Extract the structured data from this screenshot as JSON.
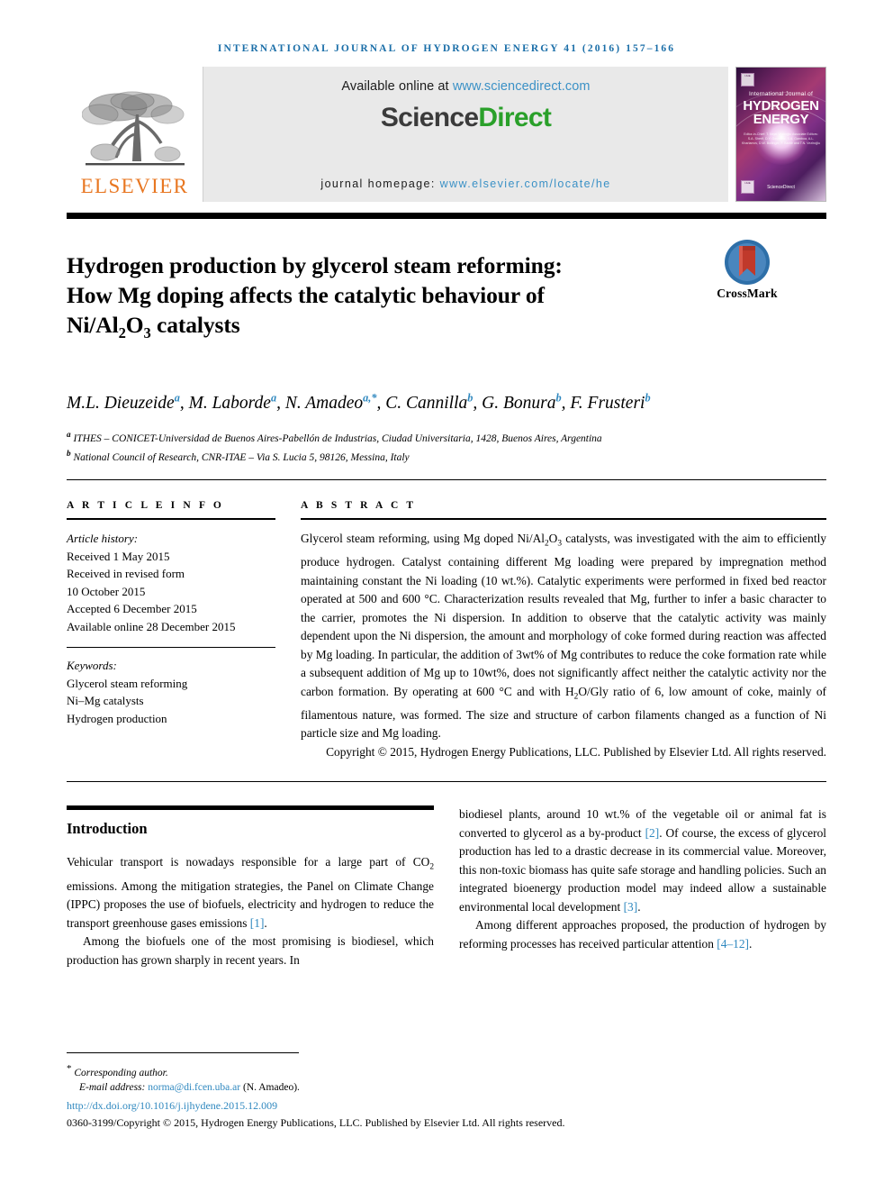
{
  "running_head": "International Journal of Hydrogen Energy 41 (2016) 157–166",
  "masthead": {
    "publisher_name": "ELSEVIER",
    "publisher_logo_name": "elsevier-tree-logo",
    "available_prefix": "Available online at ",
    "available_link": "www.sciencedirect.com",
    "sciencedirect_part1": "Science",
    "sciencedirect_part2": "Direct",
    "homepage_label": "journal homepage: ",
    "homepage_link": "www.elsevier.com/locate/he",
    "cover": {
      "line_small": "International Journal of",
      "line_big_1": "HYDROGEN",
      "line_big_2": "ENERGY",
      "editors": "Editor-in-Chief: T. Nejat Veziroğlu    Associate Editors: S.A. Sherif, D.Y. Goswami, S.A. Gamboa, A.L. Kharlamov, D.W. Bollinger, F. Barbir and T.N. Veziroğlu",
      "sciencedirect_mark": "ScienceDirect"
    }
  },
  "article": {
    "title_line1": "Hydrogen production by glycerol steam reforming:",
    "title_line2": "How Mg doping affects the catalytic behaviour of",
    "title_line3_pre": "Ni/Al",
    "title_sub1": "2",
    "title_line3_mid": "O",
    "title_sub2": "3",
    "title_line3_post": " catalysts",
    "crossmark_label": "CrossMark",
    "authors": [
      {
        "name": "M.L. Dieuzeide",
        "sup": "a",
        "sep": ", "
      },
      {
        "name": "M. Laborde",
        "sup": "a",
        "sep": ", "
      },
      {
        "name": "N. Amadeo",
        "sup": "a,*",
        "sep": ", "
      },
      {
        "name": "C. Cannilla",
        "sup": "b",
        "sep": ", "
      },
      {
        "name": "G. Bonura",
        "sup": "b",
        "sep": ", "
      },
      {
        "name": "F. Frusteri",
        "sup": "b",
        "sep": ""
      }
    ],
    "affiliations": [
      {
        "marker": "a",
        "text": "ITHES – CONICET-Universidad de Buenos Aires-Pabellón de Industrias, Ciudad Universitaria, 1428, Buenos Aires, Argentina"
      },
      {
        "marker": "b",
        "text": "National Council of Research, CNR-ITAE – Via S. Lucia 5, 98126, Messina, Italy"
      }
    ]
  },
  "article_info": {
    "heading": "A R T I C L E   I N F O",
    "history_label": "Article history:",
    "history": [
      "Received 1 May 2015",
      "Received in revised form",
      "10 October 2015",
      "Accepted 6 December 2015",
      "Available online 28 December 2015"
    ],
    "keywords_label": "Keywords:",
    "keywords": [
      "Glycerol steam reforming",
      "Ni–Mg catalysts",
      "Hydrogen production"
    ]
  },
  "abstract": {
    "heading": "A B S T R A C T",
    "part1": "Glycerol steam reforming, using Mg doped Ni/Al",
    "sub1": "2",
    "part2": "O",
    "sub2": "3",
    "part3": " catalysts, was investigated with the aim to efficiently produce hydrogen. Catalyst containing different Mg loading were prepared by impregnation method maintaining constant the Ni loading (10 wt.%). Catalytic experiments were performed in fixed bed reactor operated at 500 and 600 °C. Characterization results revealed that Mg, further to infer a basic character to the carrier, promotes the Ni dispersion. In addition to observe that the catalytic activity was mainly dependent upon the Ni dispersion, the amount and morphology of coke formed during reaction was affected by Mg loading. In particular, the addition of 3wt% of Mg contributes to reduce the coke formation rate while a subsequent addition of Mg up to 10wt%, does not significantly affect neither the catalytic activity nor the carbon formation. By operating at 600 °C and with H",
    "sub3": "2",
    "part4": "O/Gly ratio of 6, low amount of coke, mainly of filamentous nature, was formed. The size and structure of carbon filaments changed as a function of Ni particle size and Mg loading.",
    "copyright": "Copyright © 2015, Hydrogen Energy Publications, LLC. Published by Elsevier Ltd. All rights reserved."
  },
  "body": {
    "section_title": "Introduction",
    "left": {
      "p1_a": "Vehicular transport is nowadays responsible for a large part of CO",
      "p1_sub": "2",
      "p1_b": " emissions. Among the mitigation strategies, the Panel on Climate Change (IPPC) proposes the use of biofuels, electricity and hydrogen to reduce the transport greenhouse gases emissions ",
      "p1_cite": "[1]",
      "p1_c": ".",
      "p2": "Among the biofuels one of the most promising is biodiesel, which production has grown sharply in recent years. In"
    },
    "right": {
      "p1_a": "biodiesel plants, around 10 wt.% of the vegetable oil or animal fat is converted to glycerol as a by-product ",
      "p1_cite1": "[2]",
      "p1_b": ". Of course, the excess of glycerol production has led to a drastic decrease in its commercial value. Moreover, this non-toxic biomass has quite safe storage and handling policies. Such an integrated bioenergy production model may indeed allow a sustainable environmental local development ",
      "p1_cite2": "[3]",
      "p1_c": ".",
      "p2_a": "Among different approaches proposed, the production of hydrogen by reforming processes has received particular attention ",
      "p2_cite": "[4–12]",
      "p2_b": "."
    }
  },
  "footer": {
    "corresponding": "Corresponding author.",
    "email_label": "E-mail address: ",
    "email": "norma@di.fcen.uba.ar",
    "email_after": " (N. Amadeo).",
    "doi": "http://dx.doi.org/10.1016/j.ijhydene.2015.12.009",
    "issn_copyright": "0360-3199/Copyright © 2015, Hydrogen Energy Publications, LLC. Published by Elsevier Ltd. All rights reserved."
  },
  "colors": {
    "link_blue": "#2f88bf",
    "header_blue": "#1a6ea8",
    "elsevier_orange": "#E87722",
    "sciencedirect_green": "#2aa02a"
  }
}
